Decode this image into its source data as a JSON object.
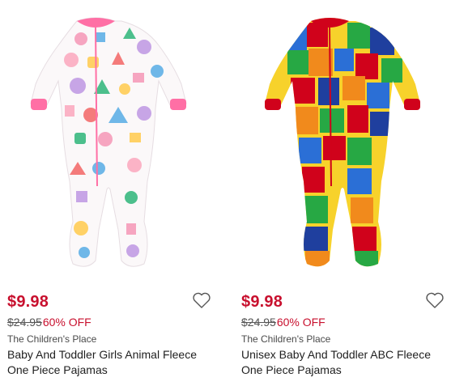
{
  "products": [
    {
      "price": "$9.98",
      "was_price": "$24.95",
      "discount": "60% OFF",
      "brand": "The Children's Place",
      "title": "Baby And Toddler Girls Animal Fleece One Piece Pajamas",
      "image": "pink animal print footed pajama",
      "accent": "#ff6fa5",
      "icon": "heart-outline-icon"
    },
    {
      "price": "$9.98",
      "was_price": "$24.95",
      "discount": "60% OFF",
      "brand": "The Children's Place",
      "title": "Unisex Baby And Toddler ABC Fleece One Piece Pajamas",
      "image": "colorful alphabet print footed pajama",
      "accent": "#d0021b",
      "icon": "heart-outline-icon"
    }
  ],
  "colors": {
    "sale_price": "#c8102e",
    "text": "#1f1f1f"
  }
}
